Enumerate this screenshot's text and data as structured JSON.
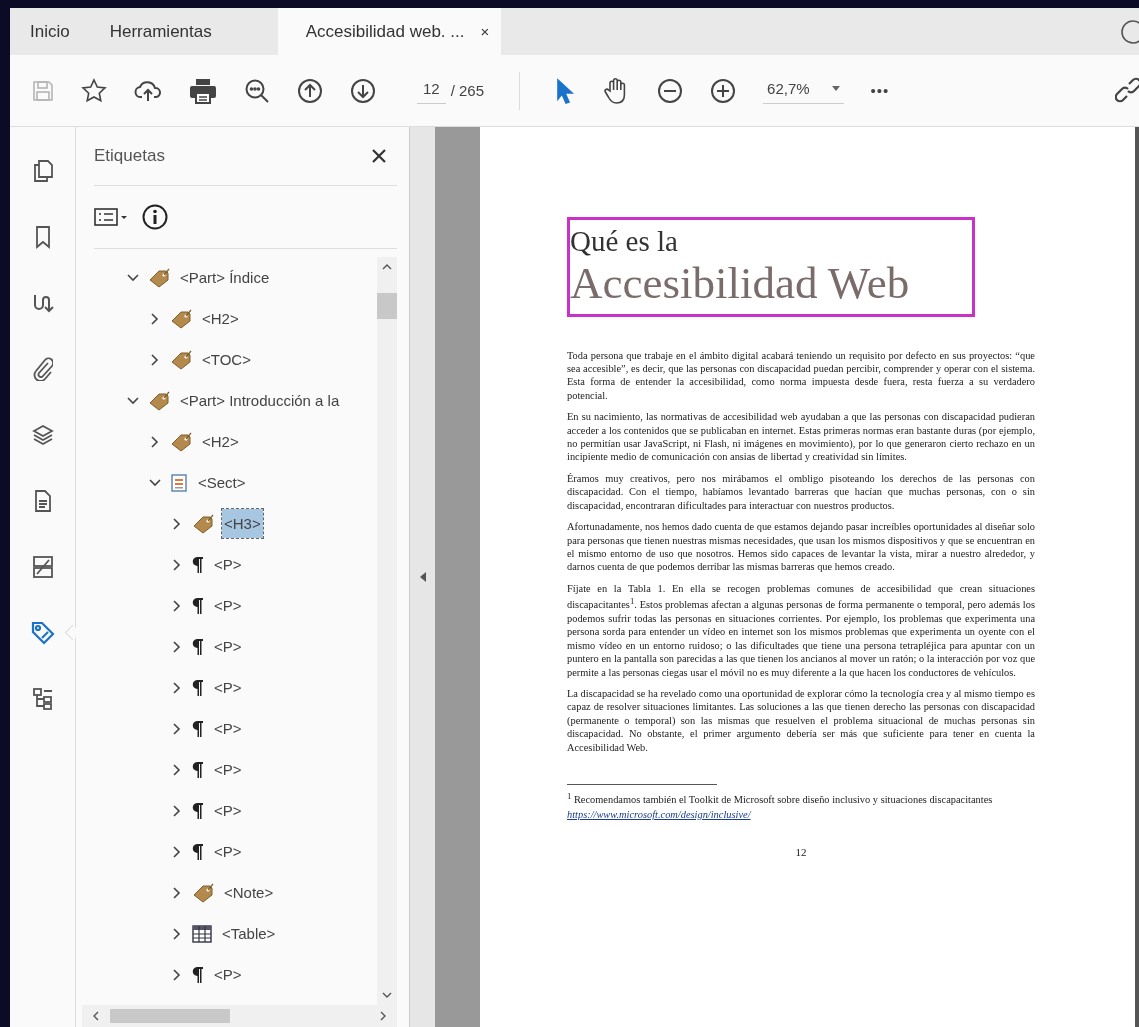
{
  "tabs": [
    {
      "label": "Inicio",
      "selected": false,
      "closable": false
    },
    {
      "label": "Herramientas",
      "selected": false,
      "closable": false
    },
    {
      "label": "Accesibilidad web. ...",
      "selected": true,
      "closable": true
    }
  ],
  "tab_close": "×",
  "toolbar": {
    "save_disabled": true,
    "page": "12",
    "page_total": "/ 265",
    "zoom": "62,7%",
    "more": "•••",
    "tools": [
      {
        "kind": "select",
        "selected": true
      },
      {
        "kind": "hand",
        "selected": false
      }
    ]
  },
  "rail": [
    {
      "kind": "pages",
      "selected": false
    },
    {
      "kind": "bookmark",
      "selected": false
    },
    {
      "kind": "signature",
      "selected": false
    },
    {
      "kind": "attachment",
      "selected": false
    },
    {
      "kind": "layers",
      "selected": false
    },
    {
      "kind": "document",
      "selected": false
    },
    {
      "kind": "compare",
      "selected": false
    },
    {
      "kind": "tags",
      "selected": true
    },
    {
      "kind": "structure",
      "selected": false
    }
  ],
  "panel": {
    "title": "Etiquetas",
    "tree": [
      {
        "label": "<Part> Índice",
        "kind": "tag",
        "expanded": true,
        "selected": false,
        "children": [
          {
            "label": "<H2>",
            "kind": "tag",
            "expanded": false,
            "selected": false
          },
          {
            "label": "<TOC>",
            "kind": "tag",
            "expanded": false,
            "selected": false
          }
        ]
      },
      {
        "label": "<Part> Introducción a la",
        "kind": "tag",
        "expanded": true,
        "selected": false,
        "children": [
          {
            "label": "<H2>",
            "kind": "tag",
            "expanded": false,
            "selected": false
          },
          {
            "label": "<Sect>",
            "kind": "sect",
            "expanded": true,
            "selected": false,
            "children": [
              {
                "label": "<H3>",
                "kind": "tag",
                "expanded": false,
                "selected": true
              },
              {
                "label": "<P>",
                "kind": "paragraph",
                "expanded": false,
                "selected": false
              },
              {
                "label": "<P>",
                "kind": "paragraph",
                "expanded": false,
                "selected": false
              },
              {
                "label": "<P>",
                "kind": "paragraph",
                "expanded": false,
                "selected": false
              },
              {
                "label": "<P>",
                "kind": "paragraph",
                "expanded": false,
                "selected": false
              },
              {
                "label": "<P>",
                "kind": "paragraph",
                "expanded": false,
                "selected": false
              },
              {
                "label": "<P>",
                "kind": "paragraph",
                "expanded": false,
                "selected": false
              },
              {
                "label": "<P>",
                "kind": "paragraph",
                "expanded": false,
                "selected": false
              },
              {
                "label": "<P>",
                "kind": "paragraph",
                "expanded": false,
                "selected": false
              },
              {
                "label": "<Note>",
                "kind": "tag",
                "expanded": false,
                "selected": false
              },
              {
                "label": "<Table>",
                "kind": "table",
                "expanded": false,
                "selected": false
              },
              {
                "label": "<P>",
                "kind": "paragraph",
                "expanded": false,
                "selected": false
              }
            ]
          }
        ]
      }
    ]
  },
  "page": {
    "heading_small": "Qué es la",
    "heading_large": "Accesibilidad Web",
    "paragraphs": [
      "Toda persona que trabaje en el ámbito digital acabará teniendo un requisito por defecto en sus proyectos: “que sea accesible”, es decir, que las personas con discapacidad puedan percibir, comprender y operar con el sistema. Esta forma de entender la accesibilidad, como norma impuesta desde fuera, resta fuerza a su verdadero potencial.",
      "En su nacimiento, las normativas de accesibilidad web ayudaban a que las personas con discapacidad pudieran acceder a los contenidos que se publicaban en internet. Estas primeras normas eran bastante duras (por ejemplo, no permitían usar JavaScript, ni Flash, ni imágenes en movimiento), por lo que generaron cierto rechazo en un incipiente medio de comunicación con ansias de libertad y creatividad sin límites.",
      "Éramos muy creativos, pero nos mirábamos el ombligo pisoteando los derechos de las personas con discapacidad. Con el tiempo, habíamos levantado barreras que hacían que muchas personas, con o sin discapacidad, encontraran dificultades para interactuar con nuestros productos.",
      "Afortunadamente, nos hemos dado cuenta de que estamos dejando pasar increíbles oportunidades al diseñar solo para personas que tienen nuestras mismas necesidades, que usan los mismos dispositivos y que se encuentran en el mismo entorno de uso que nosotros. Hemos sido capaces de levantar la vista, mirar a nuestro alrededor, y darnos cuenta de que podemos derribar las mismas barreras que hemos creado.",
      "Fíjate en la Tabla 1. En ella se recogen problemas comunes de accesibilidad que crean situaciones discapacitantes$^{1}$. Estos problemas afectan a algunas personas de forma permanente o temporal, pero además los podemos sufrir todas las personas en situaciones corrientes. Por ejemplo, los problemas que experimenta una persona sorda para entender un vídeo en internet son los mismos problemas que experimenta un oyente con el mismo vídeo en un entorno ruidoso; o las dificultades que tiene una persona tetrapléjica para apuntar con un puntero en la pantalla son parecidas a las que tienen los ancianos al mover un ratón; o la interacción por voz que permite a las personas ciegas usar el móvil no es muy diferente a la que hacen los conductores de vehículos.",
      "La discapacidad se ha revelado como una oportunidad de explorar cómo la tecnología crea y al mismo tiempo es capaz de resolver situaciones limitantes. Las soluciones a las que tienen derecho las personas con discapacidad (permanente o temporal) son las mismas que resuelven el problema situacional de muchas personas sin discapacidad. No obstante, el primer argumento debería ser más que suficiente para tener en cuenta la Accesibilidad Web."
    ],
    "footnote": "$^{1}$ Recomendamos también el Toolkit de Microsoft sobre diseño inclusivo y situaciones discapacitantes",
    "footnote_link": "https://www.microsoft.com/design/inclusive/",
    "page_number": "12"
  }
}
